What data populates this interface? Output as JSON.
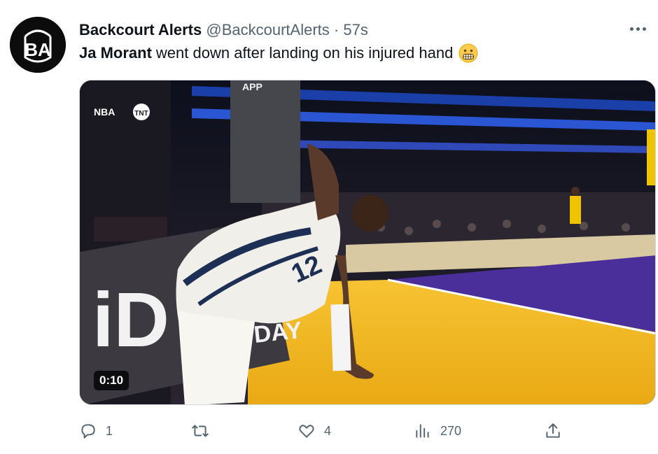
{
  "author": {
    "display_name": "Backcourt Alerts",
    "handle": "@BackcourtAlerts",
    "separator": "·",
    "time": "57s",
    "avatar_text": "BA"
  },
  "tweet": {
    "mention": "Ja Morant",
    "text": "went down after landing on his injured hand",
    "emoji": "grimacing-face"
  },
  "media": {
    "duration": "0:10",
    "broadcast_logo": "TNT",
    "league_logo": "NBA",
    "jersey_number": "12",
    "ad_board_text": "iD",
    "ad_board_text_2": "DAY",
    "stanchion_text": "APP"
  },
  "actions": {
    "replies": "1",
    "retweets": "",
    "likes": "4",
    "views": "270"
  },
  "icons": {
    "more": "more-icon",
    "reply": "reply-icon",
    "retweet": "retweet-icon",
    "like": "heart-icon",
    "views": "views-icon",
    "share": "share-icon"
  },
  "colors": {
    "text_secondary": "#536471",
    "court_yellow": "#f3b51a",
    "court_purple": "#4a2f9a"
  }
}
